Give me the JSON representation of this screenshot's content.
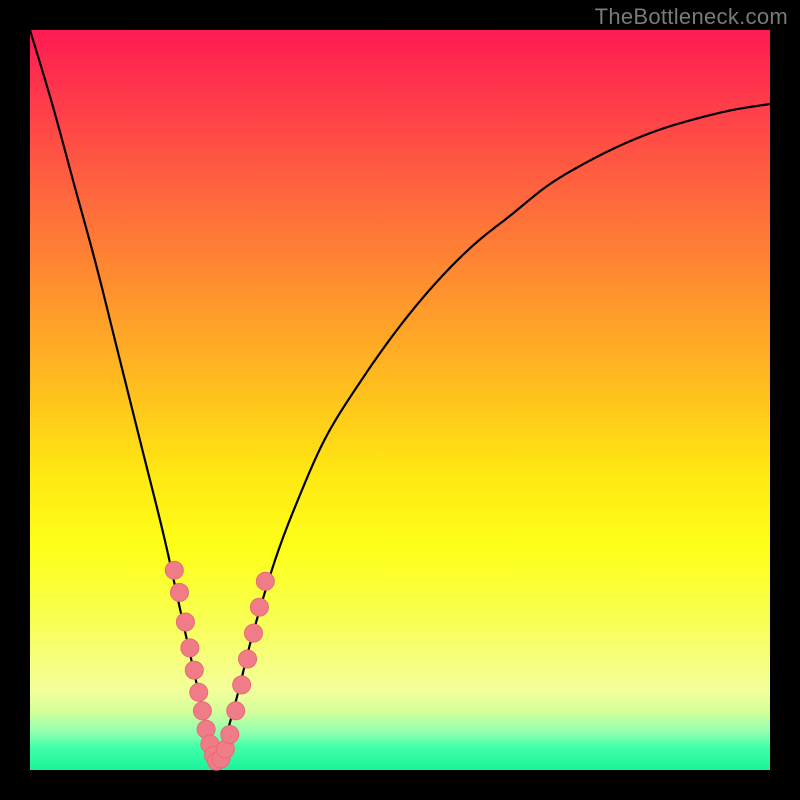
{
  "watermark": "TheBottleneck.com",
  "colors": {
    "curve": "#000000",
    "marker_fill": "#ef7c86",
    "marker_stroke": "#e96a76",
    "background_black": "#000000"
  },
  "chart_data": {
    "type": "line",
    "title": "",
    "xlabel": "",
    "ylabel": "",
    "xlim": [
      0,
      100
    ],
    "ylim": [
      0,
      100
    ],
    "grid": false,
    "legend": false,
    "comment": "Bottleneck-style V curve. y is the bottleneck percentage (0 = no bottleneck) across normalized x (0-100). Minimum near x≈25. No axis tick labels visible in source image; values are read off by shape only.",
    "series": [
      {
        "name": "bottleneck-curve",
        "x": [
          0,
          3,
          6,
          9,
          12,
          15,
          18,
          20,
          22,
          24,
          25,
          26,
          28,
          30,
          33,
          36,
          40,
          45,
          50,
          55,
          60,
          65,
          70,
          75,
          80,
          85,
          90,
          95,
          100
        ],
        "values": [
          100,
          90,
          79,
          68,
          56,
          44,
          32,
          23,
          14,
          5,
          1,
          3,
          10,
          18,
          28,
          36,
          45,
          53,
          60,
          66,
          71,
          75,
          79,
          82,
          84.5,
          86.5,
          88,
          89.2,
          90
        ]
      }
    ],
    "markers": {
      "comment": "Pink bead markers clustered on both arms near the trough",
      "points": [
        {
          "x": 19.5,
          "y": 27
        },
        {
          "x": 20.2,
          "y": 24
        },
        {
          "x": 21.0,
          "y": 20
        },
        {
          "x": 21.6,
          "y": 16.5
        },
        {
          "x": 22.2,
          "y": 13.5
        },
        {
          "x": 22.8,
          "y": 10.5
        },
        {
          "x": 23.3,
          "y": 8
        },
        {
          "x": 23.8,
          "y": 5.5
        },
        {
          "x": 24.3,
          "y": 3.5
        },
        {
          "x": 24.8,
          "y": 2
        },
        {
          "x": 25.2,
          "y": 1.2
        },
        {
          "x": 25.8,
          "y": 1.5
        },
        {
          "x": 26.4,
          "y": 2.8
        },
        {
          "x": 27.0,
          "y": 4.8
        },
        {
          "x": 27.8,
          "y": 8
        },
        {
          "x": 28.6,
          "y": 11.5
        },
        {
          "x": 29.4,
          "y": 15
        },
        {
          "x": 30.2,
          "y": 18.5
        },
        {
          "x": 31.0,
          "y": 22
        },
        {
          "x": 31.8,
          "y": 25.5
        }
      ],
      "radius": 9
    }
  }
}
